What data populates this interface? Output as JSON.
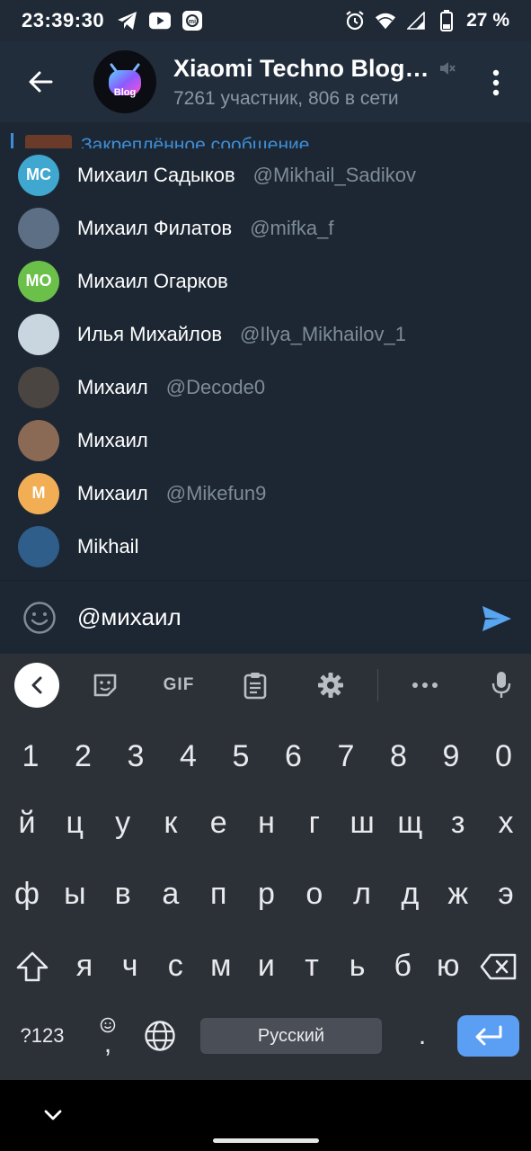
{
  "status_bar": {
    "time": "23:39:30",
    "battery_percent": "27 %",
    "icons_left": [
      "telegram-icon",
      "youtube-icon",
      "mi-icon"
    ],
    "icons_right": [
      "alarm-icon",
      "wifi-icon",
      "signal-icon",
      "battery-icon"
    ]
  },
  "header": {
    "title": "Xiaomi Techno Blog…",
    "subtitle": "7261 участник, 806 в сети",
    "avatar_label": "Blog",
    "muted": true
  },
  "pinned": {
    "label": "Закреплённое сообщение"
  },
  "mentions": [
    {
      "initials": "МС",
      "color": "#3fa7d0",
      "name": "Михаил Садыков",
      "username": "@Mikhail_Sadikov"
    },
    {
      "initials": "",
      "color": "#5c6f85",
      "name": "Михаил Филатов",
      "username": "@mifka_f"
    },
    {
      "initials": "МО",
      "color": "#6bc04a",
      "name": "Михаил Огарков",
      "username": ""
    },
    {
      "initials": "",
      "color": "#c9d6df",
      "name": "Илья Михайлов",
      "username": "@Ilya_Mikhailov_1"
    },
    {
      "initials": "",
      "color": "#4a4540",
      "name": "Михаил",
      "username": "@Decode0"
    },
    {
      "initials": "",
      "color": "#8a6a55",
      "name": "Михаил",
      "username": ""
    },
    {
      "initials": "М",
      "color": "#f2ae54",
      "name": "Михаил",
      "username": "@Mikefun9"
    },
    {
      "initials": "",
      "color": "#2f5e8a",
      "name": "Mikhail",
      "username": ""
    }
  ],
  "composer": {
    "text": "@михаил"
  },
  "keyboard_toolbar": {
    "gif_label": "GIF"
  },
  "keyboard": {
    "row_digits": [
      "1",
      "2",
      "3",
      "4",
      "5",
      "6",
      "7",
      "8",
      "9",
      "0"
    ],
    "row1": [
      "й",
      "ц",
      "у",
      "к",
      "е",
      "н",
      "г",
      "ш",
      "щ",
      "з",
      "х"
    ],
    "row2": [
      "ф",
      "ы",
      "в",
      "а",
      "п",
      "р",
      "о",
      "л",
      "д",
      "ж",
      "э"
    ],
    "row3": [
      "я",
      "ч",
      "с",
      "м",
      "и",
      "т",
      "ь",
      "б",
      "ю"
    ],
    "symbols_label": "?123",
    "comma_label": ",",
    "space_label": "Русский",
    "period_label": "."
  },
  "colors": {
    "accent": "#3d8ed8",
    "send": "#58a5f0",
    "enter": "#5b9ff4"
  }
}
